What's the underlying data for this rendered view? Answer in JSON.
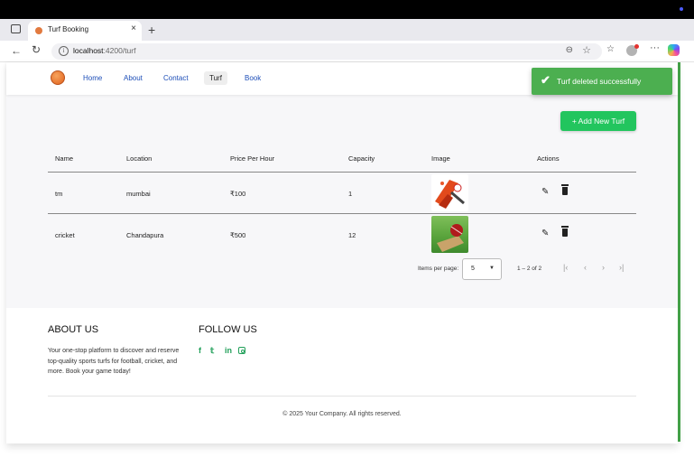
{
  "browser": {
    "tab_title": "Turf Booking",
    "tab_close": "×",
    "new_tab": "+",
    "url_host": "localhost",
    "url_path": ":4200/turf",
    "url_info": "i"
  },
  "navbar": {
    "links": [
      {
        "label": "Home"
      },
      {
        "label": "About"
      },
      {
        "label": "Contact"
      },
      {
        "label": "Turf",
        "active": true
      },
      {
        "label": "Book"
      }
    ]
  },
  "toast": {
    "message": "Turf deleted successfully",
    "color": "#4caf50"
  },
  "actions": {
    "add_label": "+ Add New Turf",
    "accent": "#22c55e"
  },
  "table": {
    "headers": [
      "Name",
      "Location",
      "Price Per Hour",
      "Capacity",
      "Image",
      "Actions"
    ],
    "rows": [
      {
        "name": "tm",
        "location": "mumbai",
        "price": "₹100",
        "capacity": "1"
      },
      {
        "name": "cricket",
        "location": "Chandapura",
        "price": "₹500",
        "capacity": "12"
      }
    ]
  },
  "paginator": {
    "items_per_page_label": "Items per page:",
    "page_size": "5",
    "range": "1 – 2 of 2"
  },
  "footer": {
    "about_heading": "ABOUT US",
    "about_text": "Your one-stop platform to discover and reserve top-quality sports turfs for football, cricket, and more. Book your game today!",
    "follow_heading": "FOLLOW US",
    "socials": [
      "facebook-icon",
      "twitter-icon",
      "linkedin-icon",
      "instagram-icon"
    ],
    "copyright": "© 2025 Your Company. All rights reserved."
  }
}
